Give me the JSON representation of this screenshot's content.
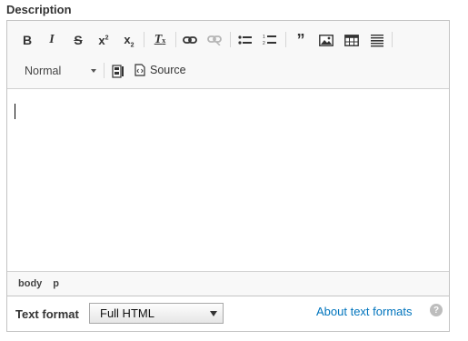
{
  "field": {
    "label": "Description"
  },
  "toolbar": {
    "row1": [
      {
        "name": "bold-button",
        "glyph": "B"
      },
      {
        "name": "italic-button",
        "glyph": "I"
      },
      {
        "name": "strikethrough-button",
        "glyph": "S"
      },
      {
        "name": "superscript-button",
        "glyph": "x²"
      },
      {
        "name": "subscript-button",
        "glyph": "x₂"
      },
      {
        "name": "remove-format-button",
        "glyph": "Tx"
      },
      {
        "name": "link-button",
        "icon": "link-icon"
      },
      {
        "name": "unlink-button",
        "icon": "unlink-icon"
      },
      {
        "name": "bulleted-list-button",
        "icon": "bulleted-list-icon"
      },
      {
        "name": "numbered-list-button",
        "icon": "numbered-list-icon"
      },
      {
        "name": "blockquote-button",
        "glyph": "❞"
      },
      {
        "name": "image-button",
        "icon": "image-icon"
      },
      {
        "name": "table-button",
        "icon": "table-icon"
      },
      {
        "name": "horizontal-line-button",
        "icon": "horizontal-line-icon"
      }
    ],
    "format_select": {
      "value": "Normal"
    },
    "source_label": "Source"
  },
  "path_bar": {
    "items": [
      "body",
      "p"
    ]
  },
  "text_format": {
    "label": "Text format",
    "selected": "Full HTML",
    "about_link": "About text formats",
    "help_glyph": "?"
  }
}
